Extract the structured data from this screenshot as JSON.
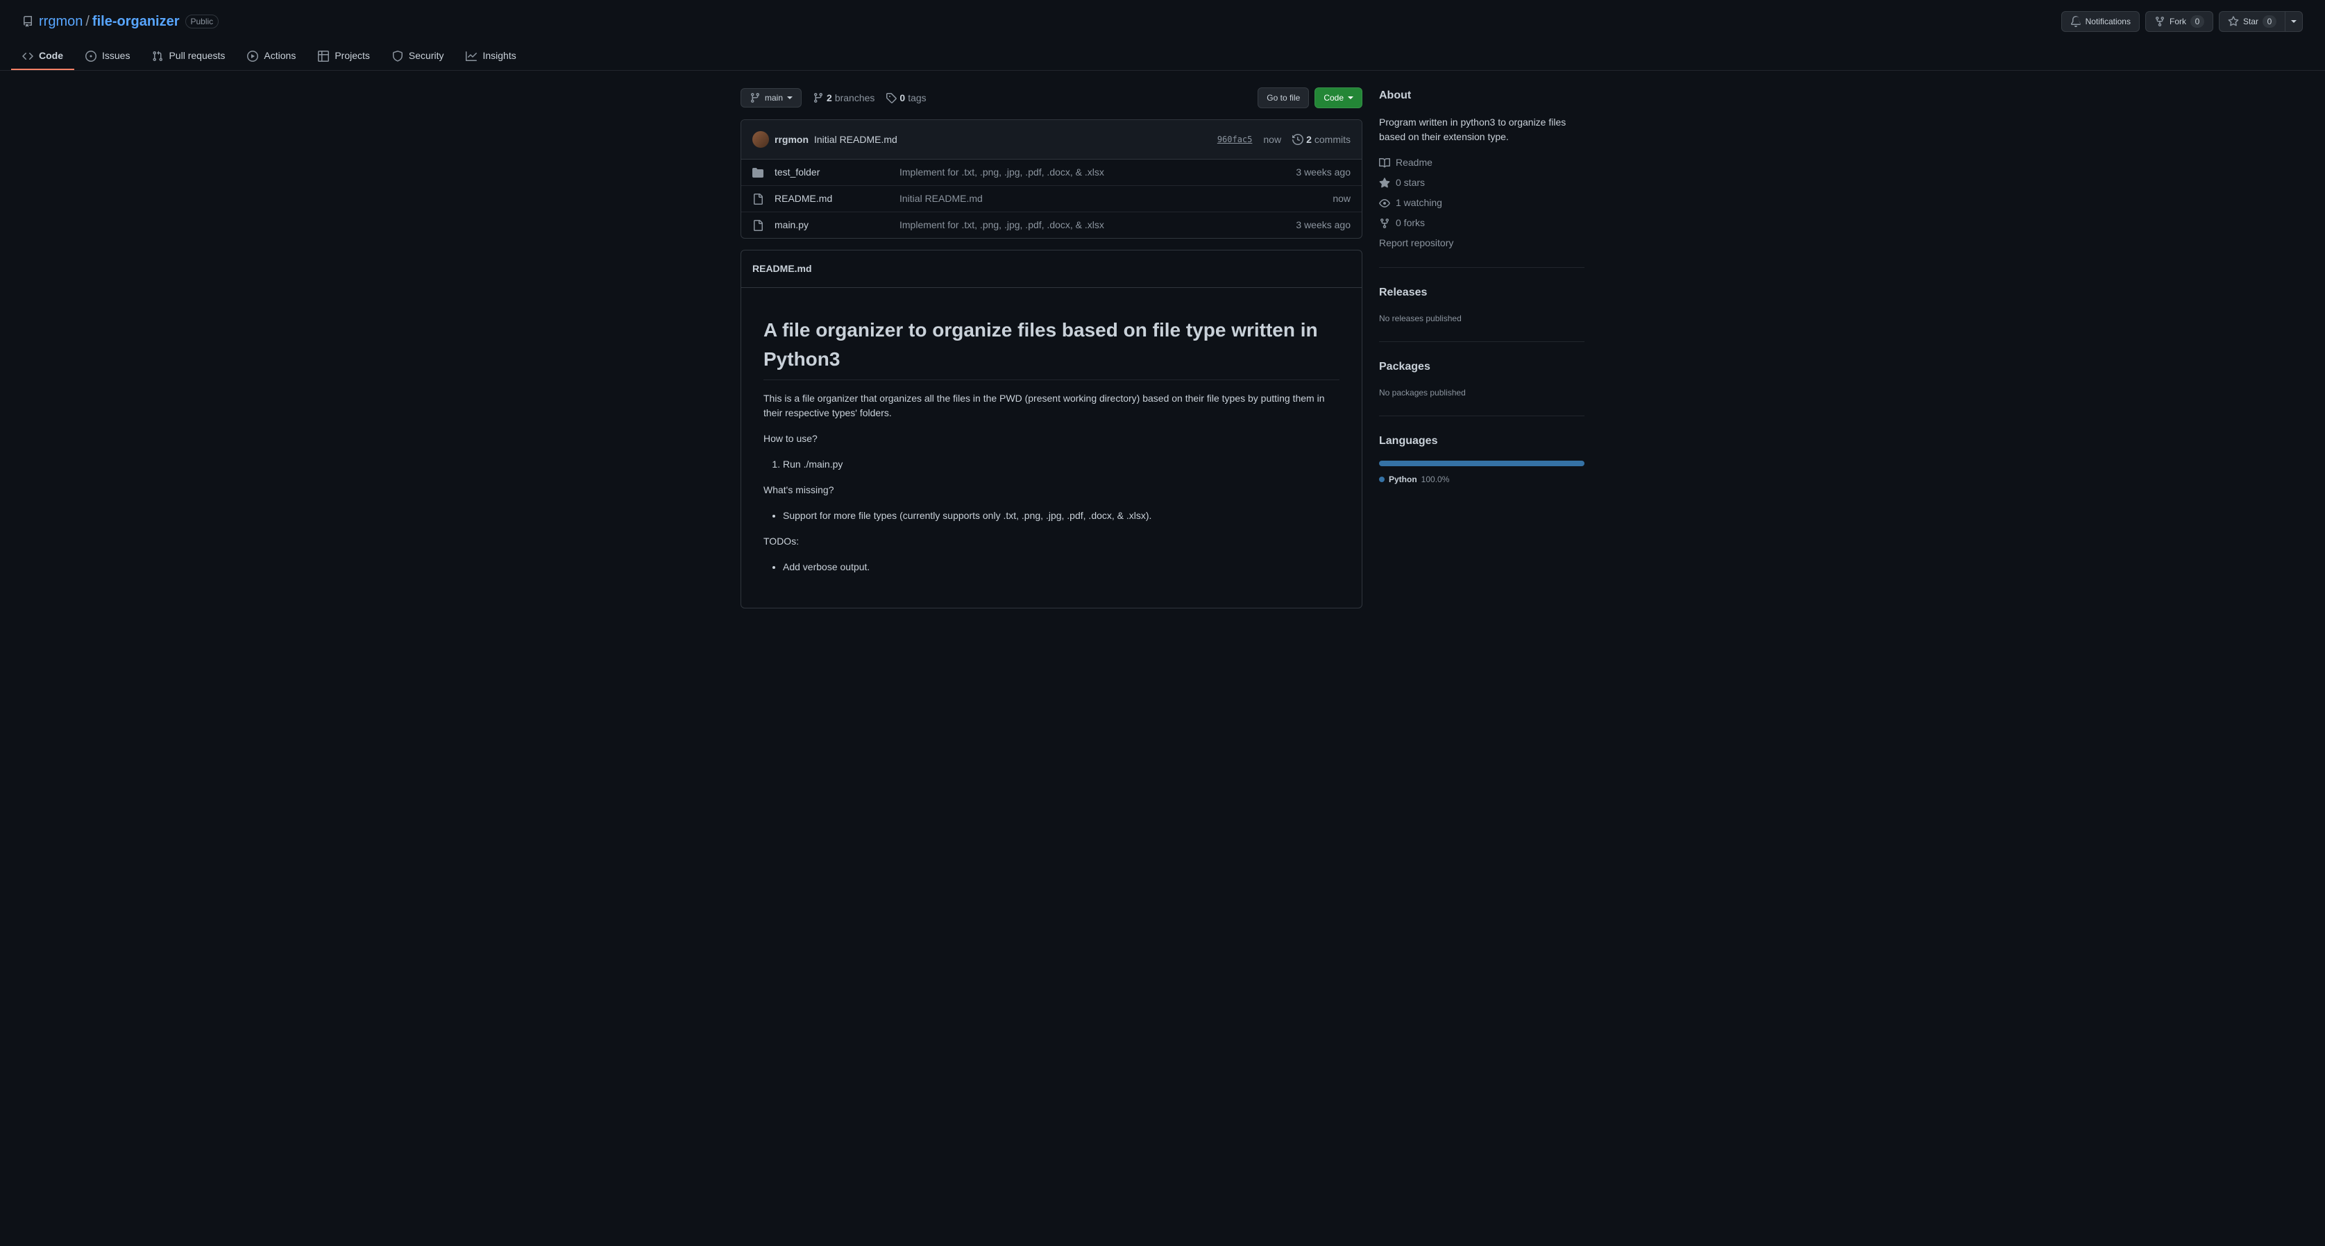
{
  "repo": {
    "owner": "rrgmon",
    "name": "file-organizer",
    "visibility": "Public"
  },
  "actions": {
    "notifications": "Notifications",
    "fork": "Fork",
    "fork_count": "0",
    "star": "Star",
    "star_count": "0"
  },
  "tabs": [
    {
      "label": "Code"
    },
    {
      "label": "Issues"
    },
    {
      "label": "Pull requests"
    },
    {
      "label": "Actions"
    },
    {
      "label": "Projects"
    },
    {
      "label": "Security"
    },
    {
      "label": "Insights"
    }
  ],
  "branch": {
    "label": "main",
    "branches_count": "2",
    "branches_label": "branches",
    "tags_count": "0",
    "tags_label": "tags"
  },
  "fileNav": {
    "goToFile": "Go to file",
    "code": "Code"
  },
  "latestCommit": {
    "author": "rrgmon",
    "message": "Initial README.md",
    "hash": "960fac5",
    "time": "now",
    "commits_count": "2",
    "commits_label": "commits"
  },
  "files": [
    {
      "type": "dir",
      "name": "test_folder",
      "msg": "Implement for .txt, .png, .jpg, .pdf, .docx, & .xlsx",
      "time": "3 weeks ago"
    },
    {
      "type": "file",
      "name": "README.md",
      "msg": "Initial README.md",
      "time": "now"
    },
    {
      "type": "file",
      "name": "main.py",
      "msg": "Implement for .txt, .png, .jpg, .pdf, .docx, & .xlsx",
      "time": "3 weeks ago"
    }
  ],
  "readme": {
    "filename": "README.md",
    "title": "A file organizer to organize files based on file type written in Python3",
    "p1": "This is a file organizer that organizes all the files in the PWD (present working directory) based on their file types by putting them in their respective types' folders.",
    "how_to": "How to use?",
    "step1": "Run ./main.py",
    "missing": "What's missing?",
    "missing1": "Support for more file types (currently supports only .txt, .png, .jpg, .pdf, .docx, & .xlsx).",
    "todos": "TODOs:",
    "todo1": "Add verbose output."
  },
  "about": {
    "heading": "About",
    "description": "Program written in python3 to organize files based on their extension type.",
    "readme": "Readme",
    "stars": "0 stars",
    "watching": "1 watching",
    "forks": "0 forks",
    "report": "Report repository"
  },
  "releases": {
    "heading": "Releases",
    "empty": "No releases published"
  },
  "packages": {
    "heading": "Packages",
    "empty": "No packages published"
  },
  "languages": {
    "heading": "Languages",
    "items": [
      {
        "name": "Python",
        "percent": "100.0%",
        "color": "#3572A5"
      }
    ]
  }
}
